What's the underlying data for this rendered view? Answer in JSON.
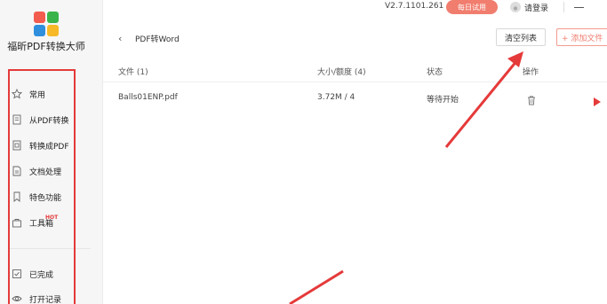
{
  "app": {
    "name": "福昕PDF转换大师",
    "version": "V2.7.1101.261",
    "trial_label": "每日试用",
    "login_label": "请登录"
  },
  "sidebar": {
    "items": [
      {
        "label": "常用",
        "icon": "star-icon"
      },
      {
        "label": "从PDF转换",
        "icon": "pdf-file-icon"
      },
      {
        "label": "转换成PDF",
        "icon": "convert-file-icon"
      },
      {
        "label": "文档处理",
        "icon": "document-icon"
      },
      {
        "label": "特色功能",
        "icon": "bookmark-icon"
      },
      {
        "label": "工具箱",
        "icon": "toolbox-icon",
        "badge": "HOT"
      },
      {
        "label": "已完成",
        "icon": "checkbox-icon"
      },
      {
        "label": "打开记录",
        "icon": "eye-icon"
      }
    ]
  },
  "header": {
    "title": "PDF转Word",
    "clear_label": "清空列表",
    "add_label": "+ 添加文件"
  },
  "table": {
    "columns": [
      "文件 (1)",
      "大小/额度 (4)",
      "状态",
      "操作"
    ],
    "rows": [
      {
        "file": "Balls01ENP.pdf",
        "size": "3.72M / 4",
        "status": "等待开始"
      }
    ]
  },
  "colors": {
    "accent": "#f07d6e",
    "annotation": "#e53a3a"
  }
}
